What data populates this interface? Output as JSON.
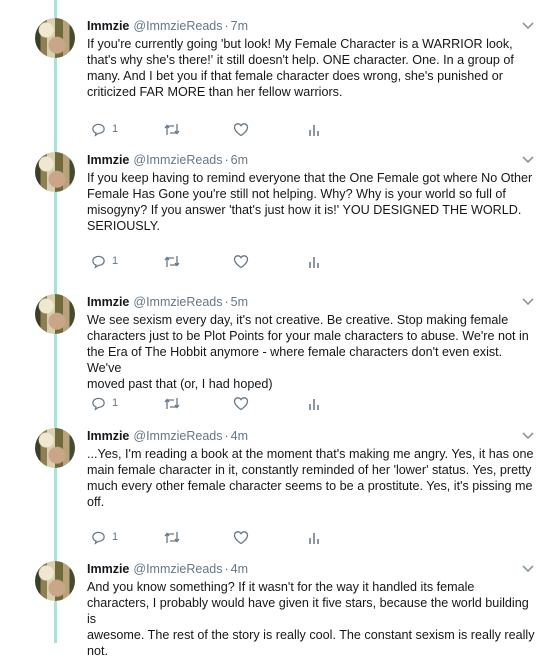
{
  "tweets": [
    {
      "name": "Immzie",
      "handle": "@ImmzieReads",
      "time": "7m",
      "text": "If you're currently going 'but look! My Female Character is a WARRIOR look,\nthat's why she's there!' it still doesn't help. ONE character. One. In a group of\nmany. And I bet you if that female character does wrong, she's punished or\ncriticized FAR MORE than her fellow warriors.",
      "reply_count": "1"
    },
    {
      "name": "Immzie",
      "handle": "@ImmzieReads",
      "time": "6m",
      "text": "If you keep having to remind everyone that the One Female got where No Other\nFemale Has Gone you're still not helping. Why? Why is your world so full of\nmisogyny? If you answer 'that's just how it is!' YOU DESIGNED THE WORLD.\nSERIOUSLY.",
      "reply_count": "1"
    },
    {
      "name": "Immzie",
      "handle": "@ImmzieReads",
      "time": "5m",
      "text": "We see sexism every day, it's not creative. Be creative. Stop making female\ncharacters just to be Plot Points for your male characters to abuse. We're not in\nthe Era of The Hobbit anymore - where female characters don't even exist. We've\nmoved past that (or, I had hoped)",
      "reply_count": "1"
    },
    {
      "name": "Immzie",
      "handle": "@ImmzieReads",
      "time": "4m",
      "text": "...Yes, I'm reading a book at the moment that's making me angry. Yes, it has one\nmain female character in it, constantly reminded of her 'lower' status. Yes, pretty\nmuch every other female character seems to be a prostitute. Yes, it's pissing me\noff.",
      "reply_count": "1"
    },
    {
      "name": "Immzie",
      "handle": "@ImmzieReads",
      "time": "4m",
      "text": "And you know something? If it wasn't for the way it handled its female\ncharacters, I probably would have given it five stars, because the world building is\nawesome. The rest of the story is really cool. The constant sexism is really really\nnot.",
      "reply_count": ""
    }
  ],
  "icons": {
    "reply": "reply-icon",
    "retweet": "retweet-icon",
    "like": "heart-icon",
    "analytics": "analytics-icon",
    "more": "chevron-down-icon"
  },
  "colors": {
    "thread_line": "#a8e3d8",
    "secondary_text": "#657786",
    "primary_text": "#14171a"
  }
}
